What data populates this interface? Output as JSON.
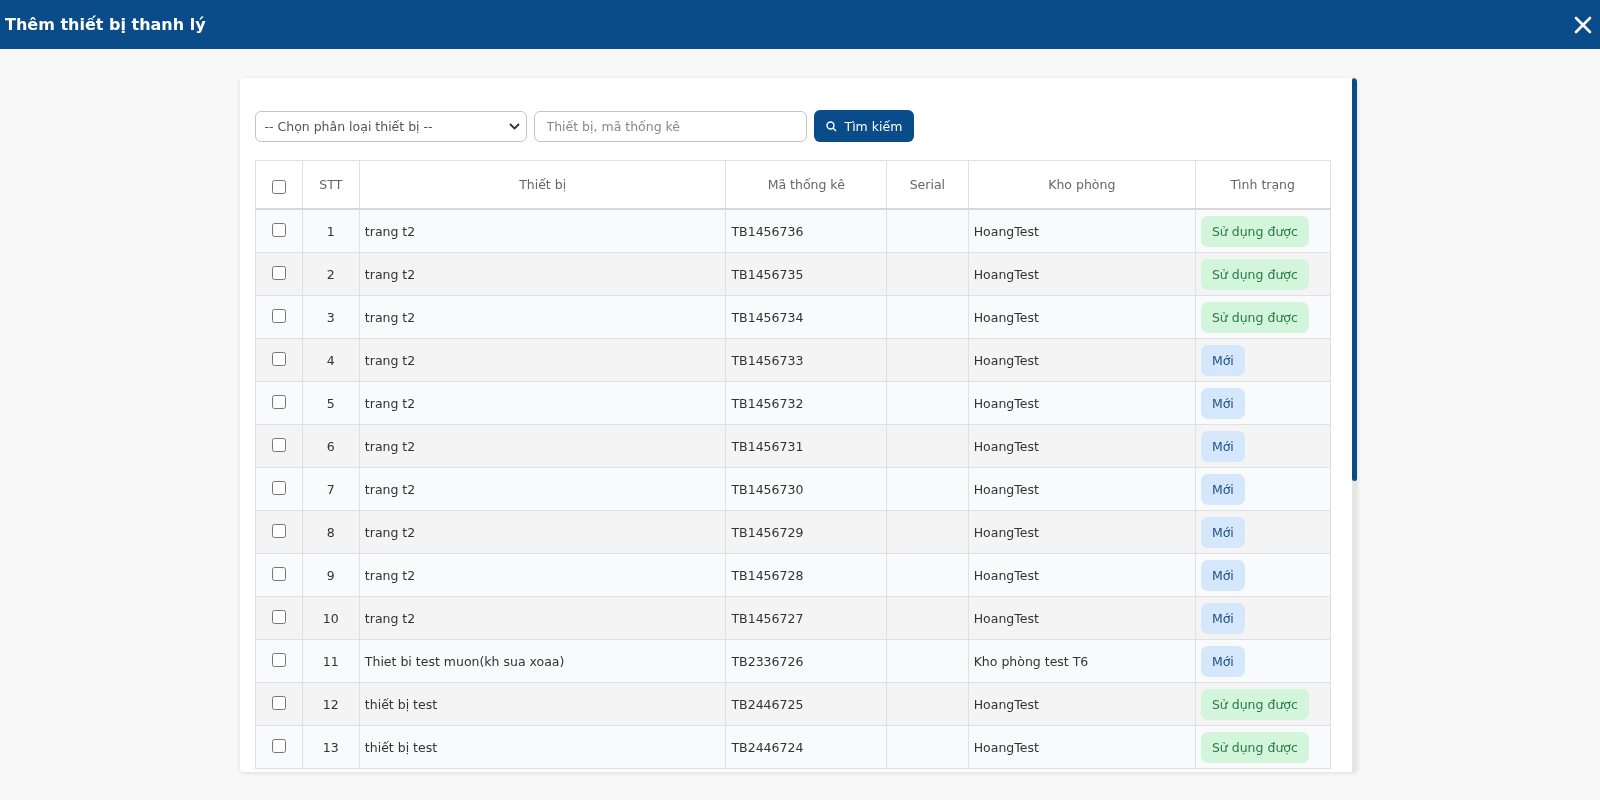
{
  "window": {
    "title": "Thêm thiết bị thanh lý"
  },
  "filters": {
    "category": {
      "value": "-- Chọn phân loại thiết bị --"
    },
    "search": {
      "placeholder": "Thiết bị, mã thống kê"
    },
    "search_button": "Tìm kiếm"
  },
  "table": {
    "select_all": {
      "checked": false
    },
    "columns": [
      "STT",
      "Thiết bị",
      "Mã thống kê",
      "Serial",
      "Kho phòng",
      "Tình trạng"
    ],
    "rows": [
      {
        "checked": false,
        "stt": "1",
        "device": "trang t2",
        "code": "TB1456736",
        "serial": "",
        "room": "HoangTest",
        "status": {
          "kind": "usable",
          "label": "Sử dụng được"
        }
      },
      {
        "checked": false,
        "stt": "2",
        "device": "trang t2",
        "code": "TB1456735",
        "serial": "",
        "room": "HoangTest",
        "status": {
          "kind": "usable",
          "label": "Sử dụng được"
        }
      },
      {
        "checked": false,
        "stt": "3",
        "device": "trang t2",
        "code": "TB1456734",
        "serial": "",
        "room": "HoangTest",
        "status": {
          "kind": "usable",
          "label": "Sử dụng được"
        }
      },
      {
        "checked": false,
        "stt": "4",
        "device": "trang t2",
        "code": "TB1456733",
        "serial": "",
        "room": "HoangTest",
        "status": {
          "kind": "new",
          "label": "Mới"
        }
      },
      {
        "checked": false,
        "stt": "5",
        "device": "trang t2",
        "code": "TB1456732",
        "serial": "",
        "room": "HoangTest",
        "status": {
          "kind": "new",
          "label": "Mới"
        }
      },
      {
        "checked": false,
        "stt": "6",
        "device": "trang t2",
        "code": "TB1456731",
        "serial": "",
        "room": "HoangTest",
        "status": {
          "kind": "new",
          "label": "Mới"
        }
      },
      {
        "checked": false,
        "stt": "7",
        "device": "trang t2",
        "code": "TB1456730",
        "serial": "",
        "room": "HoangTest",
        "status": {
          "kind": "new",
          "label": "Mới"
        }
      },
      {
        "checked": false,
        "stt": "8",
        "device": "trang t2",
        "code": "TB1456729",
        "serial": "",
        "room": "HoangTest",
        "status": {
          "kind": "new",
          "label": "Mới"
        }
      },
      {
        "checked": false,
        "stt": "9",
        "device": "trang t2",
        "code": "TB1456728",
        "serial": "",
        "room": "HoangTest",
        "status": {
          "kind": "new",
          "label": "Mới"
        }
      },
      {
        "checked": false,
        "stt": "10",
        "device": "trang t2",
        "code": "TB1456727",
        "serial": "",
        "room": "HoangTest",
        "status": {
          "kind": "new",
          "label": "Mới"
        }
      },
      {
        "checked": false,
        "stt": "11",
        "device": "Thiet bi test muon(kh sua xoaa)",
        "code": "TB2336726",
        "serial": "",
        "room": "Kho phòng test T6",
        "status": {
          "kind": "new",
          "label": "Mới"
        }
      },
      {
        "checked": false,
        "stt": "12",
        "device": "thiết bị test",
        "code": "TB2446725",
        "serial": "",
        "room": "HoangTest",
        "status": {
          "kind": "usable",
          "label": "Sử dụng được"
        }
      },
      {
        "checked": false,
        "stt": "13",
        "device": "thiết bị test",
        "code": "TB2446724",
        "serial": "",
        "room": "HoangTest",
        "status": {
          "kind": "usable",
          "label": "Sử dụng được"
        }
      }
    ]
  }
}
